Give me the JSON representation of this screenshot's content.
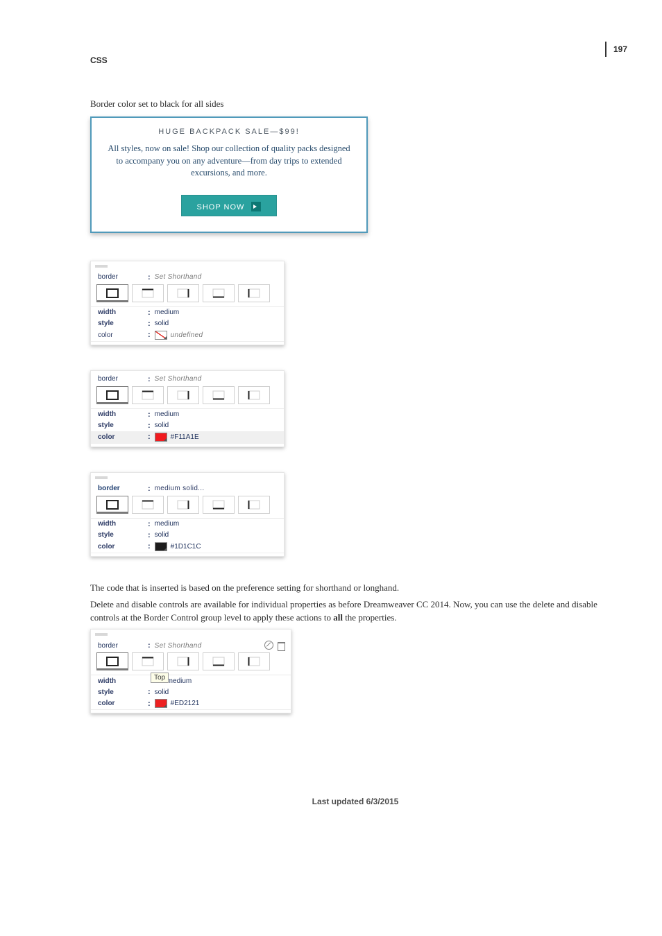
{
  "page_number": "197",
  "section_label": "CSS",
  "caption": "Border color set to black for all sides",
  "ad": {
    "title": "HUGE BACKPACK SALE—$99!",
    "copy": "All styles, now on sale! Shop our collection of quality packs designed to accompany you on any adventure—from day trips to extended excursions, and more.",
    "button": "SHOP NOW"
  },
  "panel1": {
    "border_label": "border",
    "border_value": "Set Shorthand",
    "width_label": "width",
    "width_value": "medium",
    "style_label": "style",
    "style_value": "solid",
    "color_label": "color",
    "color_value": "undefined"
  },
  "panel2": {
    "border_label": "border",
    "border_value": "Set Shorthand",
    "width_label": "width",
    "width_value": "medium",
    "style_label": "style",
    "style_value": "solid",
    "color_label": "color",
    "color_swatch": "#F11A1E",
    "color_value": "#F11A1E"
  },
  "panel3": {
    "border_label": "border",
    "border_value": "medium solid...",
    "width_label": "width",
    "width_value": "medium",
    "style_label": "style",
    "style_value": "solid",
    "color_label": "color",
    "color_swatch": "#1D1C1C",
    "color_value": "#1D1C1C"
  },
  "para1": "The code that is inserted is based on the preference setting for shorthand or longhand.",
  "para2_a": "Delete and disable controls are available for individual properties as before Dreamweaver CC 2014. Now, you can use the delete and disable controls at the Border Control group level to apply these actions to ",
  "para2_bold": "all",
  "para2_b": " the properties.",
  "panel4": {
    "border_label": "border",
    "border_value": "Set Shorthand",
    "width_label": "width",
    "width_value": "medium",
    "style_label": "style",
    "style_value": "solid",
    "color_label": "color",
    "color_swatch": "#ED2121",
    "color_value": "#ED2121",
    "tooltip": "Top"
  },
  "footer": "Last updated 6/3/2015"
}
